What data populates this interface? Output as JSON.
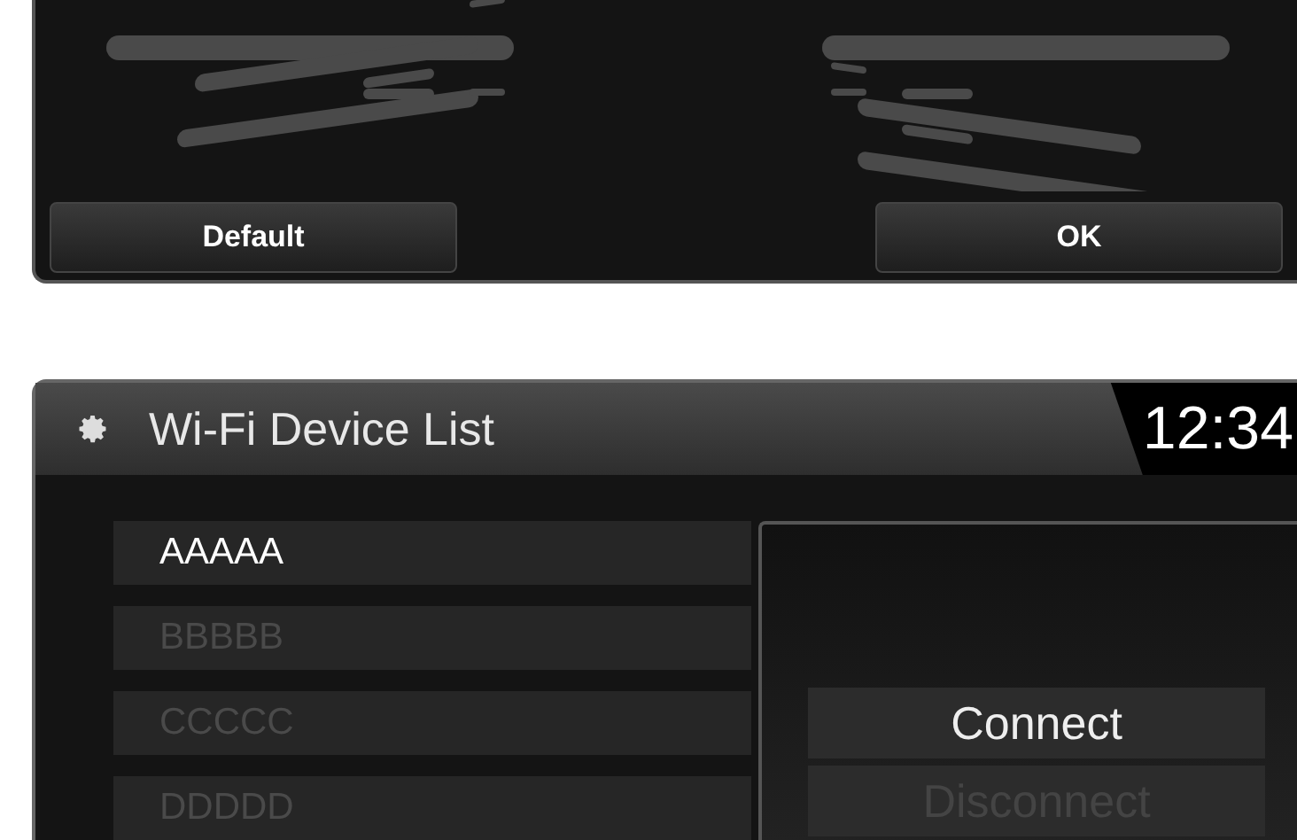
{
  "top_screen": {
    "buttons": [
      {
        "label": "Default"
      },
      {
        "label": "OK"
      }
    ]
  },
  "wifi_screen": {
    "title": "Wi-Fi Device List",
    "clock": "12:34",
    "devices": [
      {
        "name": "AAAAA",
        "disabled": false
      },
      {
        "name": "BBBBB",
        "disabled": true
      },
      {
        "name": "CCCCC",
        "disabled": true
      },
      {
        "name": "DDDDD",
        "disabled": true
      }
    ],
    "menu": [
      {
        "label": "Connect",
        "disabled": false
      },
      {
        "label": "Disconnect",
        "disabled": true
      }
    ]
  }
}
